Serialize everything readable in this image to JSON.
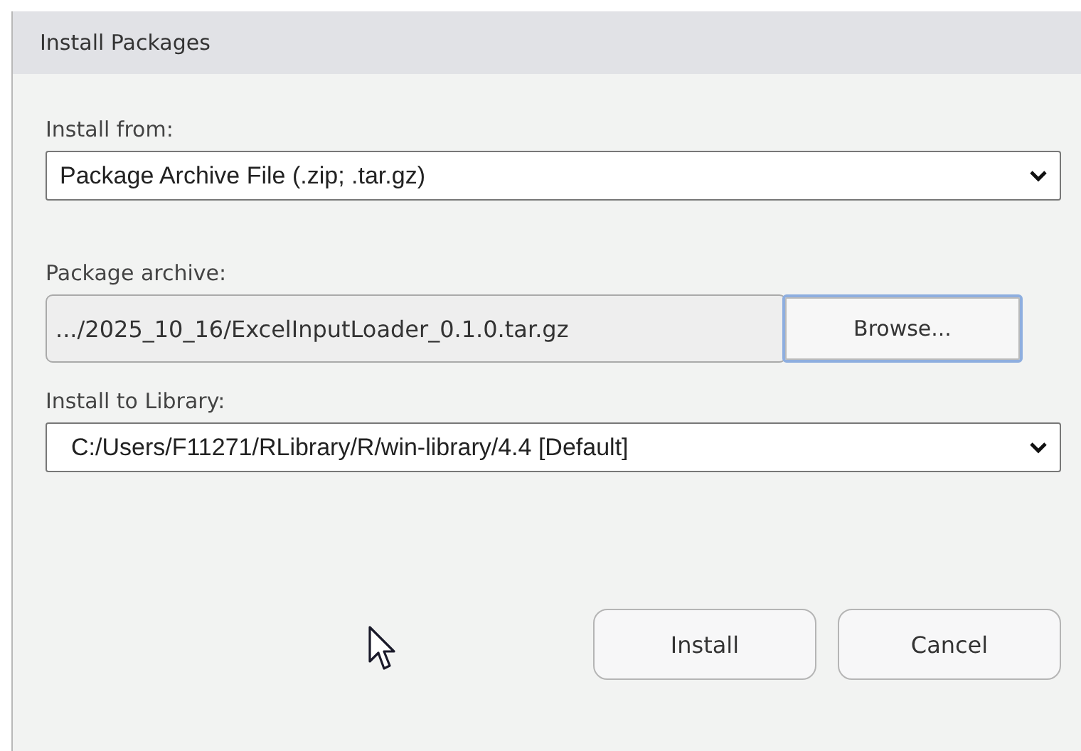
{
  "window": {
    "title": "Install Packages"
  },
  "install_from": {
    "label": "Install from:",
    "value": "Package Archive File (.zip; .tar.gz)"
  },
  "package_archive": {
    "label": "Package archive:",
    "value": ".../2025_10_16/ExcelInputLoader_0.1.0.tar.gz",
    "browse_button": {
      "label": "Browse...",
      "focused": true
    }
  },
  "install_to_library": {
    "label": "Install to Library:",
    "value": "C:/Users/F11271/RLibrary/R/win-library/4.4 [Default]"
  },
  "buttons": [
    {
      "label": "Install"
    },
    {
      "label": "Cancel"
    }
  ]
}
